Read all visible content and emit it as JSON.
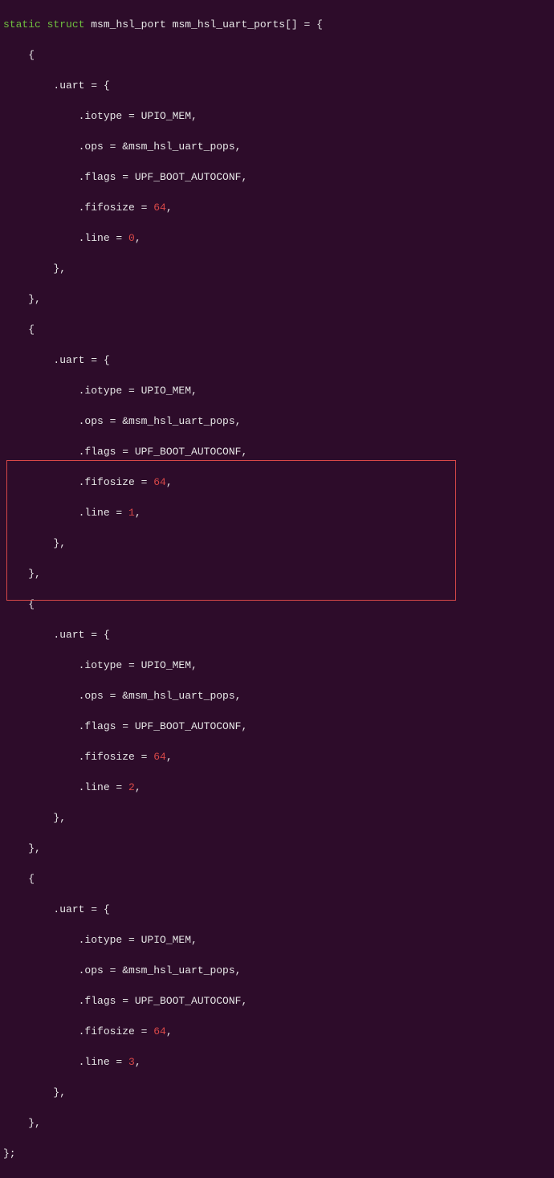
{
  "code": {
    "kw_static": "static",
    "kw_struct": "struct",
    "decl_rest": " msm_hsl_port msm_hsl_uart_ports[] = {",
    "open_brace": "    {",
    "uart_line": "        .uart = {",
    "iotype_line": "            .iotype = UPIO_MEM,",
    "ops_line": "            .ops = &msm_hsl_uart_pops,",
    "flags_line": "            .flags = UPF_BOOT_AUTOCONF,",
    "fifo_prefix": "            .fifosize = ",
    "fifo_val": "64",
    "comma": ",",
    "line_prefix": "            .line = ",
    "line_val_0": "0",
    "line_val_1": "1",
    "line_val_2": "2",
    "line_val_3": "3",
    "close_inner": "        },",
    "close_elem": "    },",
    "close_arr": "};"
  },
  "highlight": {
    "left": "8",
    "top": "573",
    "width": "558",
    "height": "173"
  }
}
